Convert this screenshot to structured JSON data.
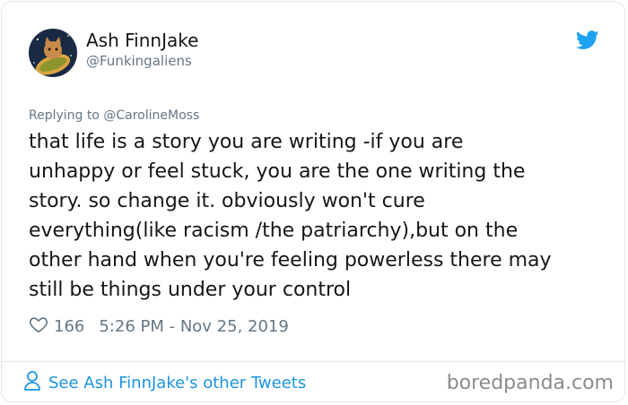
{
  "author": {
    "name": "Ash FinnJake",
    "handle": "@Funkingaliens"
  },
  "reply": {
    "text": "Replying to @CarolineMoss"
  },
  "tweet": {
    "text": "that life is a story you are writing -if you are\nunhappy or feel stuck, you are the one writing the\nstory. so change it. obviously won't cure\neverything(like racism /the patriarchy),but on the\nother hand when you're feeling powerless there may\nstill be things under your control",
    "likes": "166",
    "timestamp": "5:26 PM - Nov 25, 2019"
  },
  "footer": {
    "other_tweets_label": "See Ash FinnJake's other Tweets"
  },
  "watermark": "boredpanda.com",
  "colors": {
    "text": "#14171a",
    "secondary": "#657786",
    "link": "#1b95e0",
    "twitter_blue": "#1da1f2",
    "border": "#e1e8ed"
  },
  "icons": [
    "avatar",
    "twitter-bird-icon",
    "heart-icon",
    "person-icon"
  ]
}
